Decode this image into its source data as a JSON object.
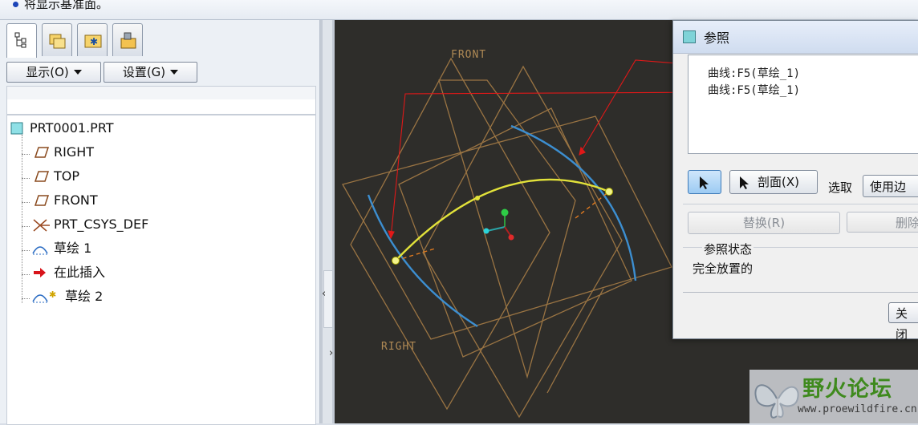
{
  "message_bar": {
    "text": "将显示基准面。"
  },
  "model_tree": {
    "display_button": "显示(O)",
    "settings_button": "设置(G)",
    "root": "PRT0001.PRT",
    "items": [
      "RIGHT",
      "TOP",
      "FRONT",
      "PRT_CSYS_DEF",
      "草绘 1",
      "在此插入",
      "草绘 2"
    ]
  },
  "graphics": {
    "plane_labels": {
      "front": "FRONT",
      "right": "RIGHT"
    }
  },
  "dialog": {
    "title": "参照",
    "references": [
      "曲线:F5(草绘_1)",
      "曲线:F5(草绘_1)"
    ],
    "section_button": "剖面(X)",
    "select_label": "选取",
    "select_value": "使用边",
    "replace_button": "替换(R)",
    "delete_button": "删除",
    "status_label": "参照状态",
    "status_value": "完全放置的",
    "close_button": "关闭"
  },
  "watermark": {
    "brand": "野火论坛",
    "url": "www.proewildfire.cn"
  },
  "colors": {
    "datum_plane": "#9a7443",
    "curve_blue": "#3c8ed0",
    "curve_yellow": "#e2e23a",
    "pointer_red": "#e01818"
  }
}
